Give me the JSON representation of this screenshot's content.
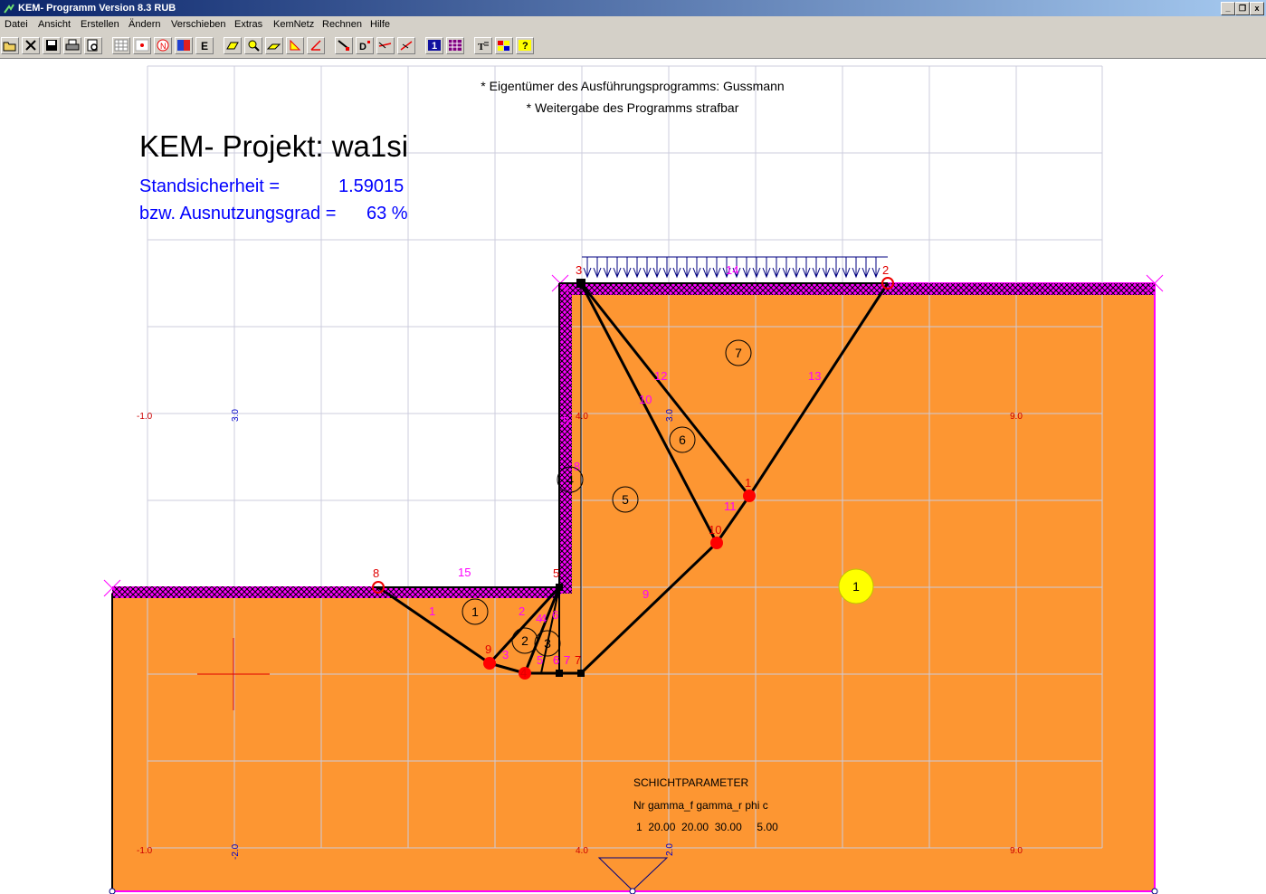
{
  "window": {
    "title": "KEM- Programm Version 8.3 RUB",
    "controls": [
      "_",
      "❐",
      "x"
    ]
  },
  "menu": [
    "Datei",
    "Ansicht",
    "Erstellen",
    "Ändern",
    "Verschieben",
    "Extras",
    "KemNetz",
    "Rechnen",
    "Hilfe"
  ],
  "toolbar": {
    "buttons": [
      {
        "name": "open-icon"
      },
      {
        "name": "close-file-icon"
      },
      {
        "name": "save-icon"
      },
      {
        "name": "print-icon"
      },
      {
        "name": "print-preview-icon"
      },
      {
        "name": "grid-icon"
      },
      {
        "name": "point-icon"
      },
      {
        "name": "node-icon",
        "label": "N"
      },
      {
        "name": "layer-icon"
      },
      {
        "name": "element-icon",
        "label": "E"
      },
      {
        "name": "surface-load-icon"
      },
      {
        "name": "zoom-icon"
      },
      {
        "name": "slope-icon"
      },
      {
        "name": "angle-icon"
      },
      {
        "name": "edit-angle-icon"
      },
      {
        "name": "move-node-icon"
      },
      {
        "name": "move-d-icon",
        "label": "D"
      },
      {
        "name": "move-line-icon"
      },
      {
        "name": "move-slope-icon"
      },
      {
        "name": "number-one-icon",
        "label": "1"
      },
      {
        "name": "matrix-icon"
      },
      {
        "name": "text-icon",
        "label": "T"
      },
      {
        "name": "color-grid-icon"
      },
      {
        "name": "help-icon",
        "label": "?"
      }
    ]
  },
  "drawing": {
    "notice_lines": [
      "* Eigentümer des Ausführungsprogramms: Gussmann",
      "* Weitergabe des Programms strafbar"
    ],
    "project_title": "KEM- Projekt: wa1si",
    "safety_label": "Standsicherheit =",
    "safety_value": "1.59015",
    "utilization_label": "bzw. Ausnutzungsgrad =",
    "utilization_value": "63 %",
    "grid_labels_red": [
      "-1.0",
      "4.0",
      "9.0",
      "-1.0",
      "4.0",
      "9.0"
    ],
    "grid_labels_blue": [
      "3.0",
      "3.0",
      "-2.0",
      "2.0"
    ],
    "node_labels": [
      "3",
      "2",
      "1",
      "10",
      "9",
      "8",
      "5",
      "4",
      "6",
      "7",
      "7"
    ],
    "element_labels": [
      "1",
      "2",
      "3",
      "4",
      "5",
      "6",
      "7"
    ],
    "line_labels": [
      "14",
      "12",
      "10",
      "13",
      "11",
      "9",
      "15",
      "1",
      "2",
      "3",
      "4",
      "5",
      "6",
      "7",
      "5",
      "6",
      "4",
      "8"
    ],
    "layer_label": "1",
    "soil_color": "#fd9632",
    "boundary_color": "#ff00ff",
    "parameters": {
      "heading": "SCHICHTPARAMETER",
      "columns": "Nr gamma_f gamma_r phi c",
      "row": "1  20.00  20.00  30.00     5.00"
    }
  }
}
